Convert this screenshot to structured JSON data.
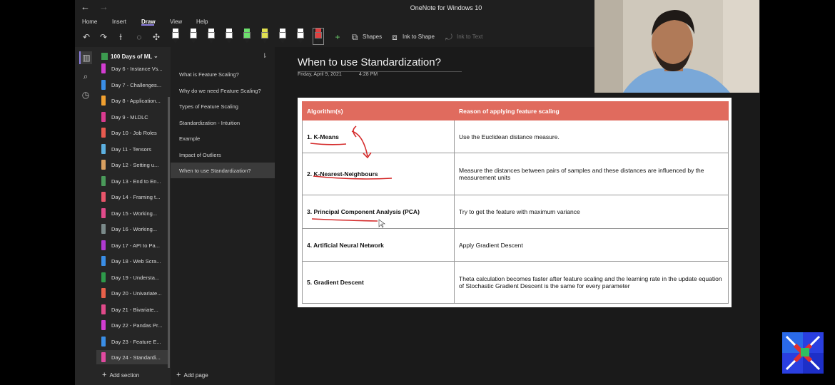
{
  "window": {
    "title": "OneNote for Windows 10"
  },
  "menu": [
    "Home",
    "Insert",
    "Draw",
    "View",
    "Help"
  ],
  "menu_active": "Draw",
  "toolbar": {
    "pens": [
      {
        "color": "#ffffff"
      },
      {
        "color": "#ffffff"
      },
      {
        "color": "#ffffff"
      },
      {
        "color": "#ffffff"
      },
      {
        "color": "#6de06d"
      },
      {
        "color": "#e0e050"
      },
      {
        "color": "#ffffff"
      },
      {
        "color": "#ffffff"
      },
      {
        "color": "#e04040"
      }
    ],
    "shapes_label": "Shapes",
    "ink_to_shape_label": "Ink to Shape",
    "ink_to_text_label": "Ink to Text"
  },
  "notebook": {
    "name": "100 Days of ML",
    "sections": [
      {
        "label": "Day 6 - Instance Vs...",
        "color": "#d23dd0"
      },
      {
        "label": "Day 7 - Challenges...",
        "color": "#3a8ee6"
      },
      {
        "label": "Day 8 - Application...",
        "color": "#f0a030"
      },
      {
        "label": "Day 9 - MLDLC",
        "color": "#d93b8f"
      },
      {
        "label": "Day 10 - Job Roles",
        "color": "#e85a4f"
      },
      {
        "label": "Day 11 - Tensors",
        "color": "#5cb0e0"
      },
      {
        "label": "Day 12 - Setting u...",
        "color": "#d8a060"
      },
      {
        "label": "Day 13 - End to En...",
        "color": "#4a9a5a"
      },
      {
        "label": "Day 14 - Framing t...",
        "color": "#e8556a"
      },
      {
        "label": "Day 15 - Working...",
        "color": "#e04a8a"
      },
      {
        "label": "Day 16 - Working...",
        "color": "#7a8a8a"
      },
      {
        "label": "Day 17 - API to Pa...",
        "color": "#b03ad0"
      },
      {
        "label": "Day 18 - Web Scra...",
        "color": "#3a8ee6"
      },
      {
        "label": "Day 19 - Understa...",
        "color": "#2e9a4a"
      },
      {
        "label": "Day 20 - Univariate...",
        "color": "#e8604a"
      },
      {
        "label": "Day 21 - Bivariate...",
        "color": "#e04a8a"
      },
      {
        "label": "Day 22 - Pandas Pr...",
        "color": "#d23dd0"
      },
      {
        "label": "Day 23 - Feature E...",
        "color": "#3a8ee6"
      },
      {
        "label": "Day 24 - Standardi...",
        "color": "#e04aa0"
      }
    ],
    "add_section": "Add section"
  },
  "pages": {
    "items": [
      "What is Feature Scaling?",
      "Why do we need Feature Scaling?",
      "Types of Feature Scaling",
      "Standardization - Intuition",
      "Example",
      "Impact of Outliers",
      "When to use Standardization?"
    ],
    "add_page": "Add page"
  },
  "page": {
    "title": "When to use Standardization?",
    "date": "Friday, April 9, 2021",
    "time": "4:28 PM"
  },
  "table": {
    "headers": [
      "Algorithm(s)",
      "Reason of applying feature scaling"
    ],
    "rows": [
      [
        "1. K-Means",
        "Use the Euclidean distance measure."
      ],
      [
        "2. K-Nearest-Neighbours",
        "Measure the distances between pairs of samples and these distances are influenced by the measurement units"
      ],
      [
        "3. Principal Component Analysis (PCA)",
        "Try to get the feature with maximum variance"
      ],
      [
        "4. Artificial Neural Network",
        "Apply Gradient Descent"
      ],
      [
        "5. Gradient Descent",
        "Theta calculation becomes faster after feature scaling and the learning rate in the update equation of Stochastic Gradient Descent is the same for every parameter"
      ]
    ]
  },
  "colors": {
    "accent": "#8c7ee0",
    "table_header": "#e06b5e",
    "ink": "#d42a2a"
  }
}
